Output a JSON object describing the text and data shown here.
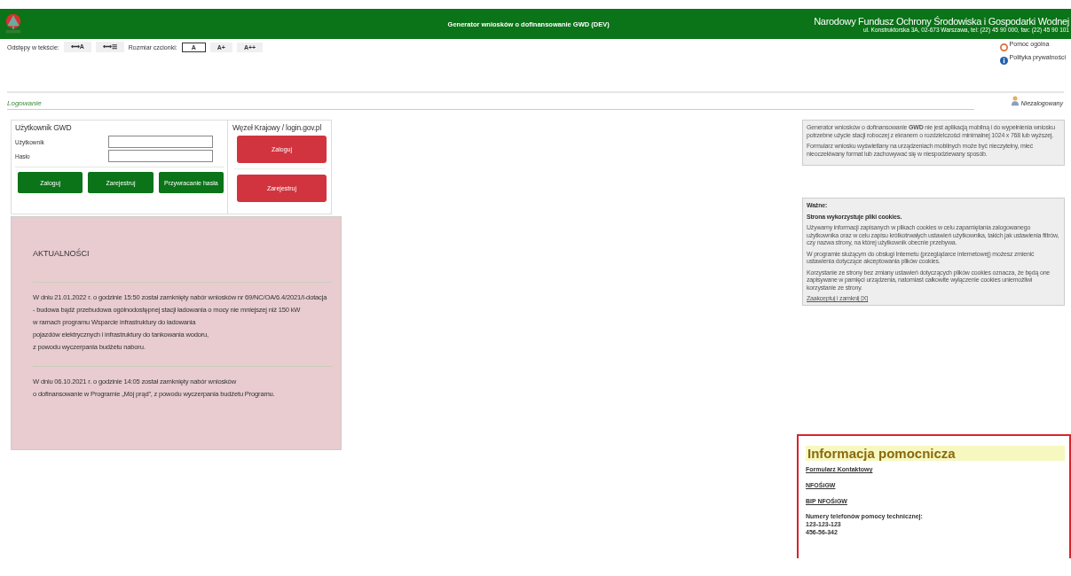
{
  "header": {
    "title": "Generator wniosków o dofinansowanie GWD (DEV)",
    "org_name": "Narodowy Fundusz Ochrony Środowiska i Gospodarki Wodnej",
    "org_address": "ul. Konstruktorska 3A, 02-673 Warszawa, tel: (22) 45 90 000, fax: (22) 45 90 101"
  },
  "toolbar": {
    "spacing_label": "Odstępy w tekście:",
    "spacing_buttons": [
      {
        "label": "⟷A",
        "selected": false
      },
      {
        "label": "⟷☰",
        "selected": false
      }
    ],
    "font_label": "Rozmiar czcionki:",
    "font_buttons": [
      {
        "label": "A",
        "selected": true
      },
      {
        "label": "A+",
        "selected": false
      },
      {
        "label": "A++",
        "selected": false
      }
    ]
  },
  "top_links": [
    {
      "label": "Pomoc ogólna",
      "kind": "help"
    },
    {
      "label": "Polityka prywatności",
      "kind": "info"
    }
  ],
  "section_title": "Logowanie",
  "user_status": "Niezalogowany",
  "login": {
    "title": "Użytkownik GWD",
    "fields": [
      "Użytkownik",
      "Hasło"
    ],
    "buttons": [
      "Zaloguj",
      "Zarejestruj",
      "Przywracanie hasła"
    ]
  },
  "national_node": {
    "title": "Węzeł Krajowy / login.gov.pl",
    "buttons": [
      "Zaloguj",
      "Zarejestruj"
    ]
  },
  "news": {
    "title": "AKTUALNOŚCI",
    "items": [
      [
        "W dniu 21.01.2022 r. o godzinie 15:50 został zamknięty nabór wniosków nr 69/NC/OA/6.4/2021/I-dotacja",
        "- budowa bądź przebudowa ogólnodostępnej stacji ładowania o mocy nie mniejszej niż 150 kW",
        "w ramach programu Wsparcie infrastruktury do ładowania",
        "pojazdów elektrycznych i infrastruktury do tankowania wodoru,",
        "z powodu wyczerpania budżetu naboru."
      ],
      [
        "W dniu 06.10.2021 r. o godzinie 14:05 został zamknięty nabór wniosków",
        "o dofinansowanie w Programie „Mój prąd”, z powodu wyczerpania budżetu Programu."
      ]
    ]
  },
  "mobile_notice": [
    "Generator wniosków o dofinansowanie **GWD** nie jest aplikacją mobilną i do wypełnienia wniosku potrzebne użycie stacji roboczej z ekranem o rozdzielczości minimalnej 1024 x 768 lub wyższej.",
    "Formularz wniosku wyświetlany na urządzeniach mobilnych może być nieczytelny, mieć nieoczekiwany format lub zachowywać się w niespodziewany sposób."
  ],
  "cookies": {
    "heading": "Ważne:",
    "title": "Strona wykorzystuje pliki cookies.",
    "paragraphs": [
      "Używamy informacji zapisanych w plikach cookies w celu zapamiętania zalogowanego użytkownika oraz w celu zapisu krótkotrwałych ustawień użytkownika, takich jak ustawienia filtrów, czy nazwa strony, na której użytkownik obecnie przebywa.",
      "W programie służącym do obsługi Internetu (przeglądarce internetowej) możesz zmienić ustawienia dotyczące akceptowania plików cookies.",
      "Korzystanie ze strony bez zmiany ustawień dotyczących plików cookies oznacza, że będą one zapisywane w pamięci urządzenia, natomiast całkowite wyłączenie cookies uniemożliwi korzystanie ze strony."
    ],
    "accept_link": "Zaakceptuj i zamknij [X]"
  },
  "help_box": {
    "title": "Informacja pomocnicza",
    "links": [
      "Formularz Kontaktowy",
      "NFOŚiGW",
      "BIP NFOŚiGW"
    ],
    "phones_label": "Numery telefonów pomocy technicznej:",
    "phones": [
      "123-123-123",
      "456-56-342"
    ]
  }
}
